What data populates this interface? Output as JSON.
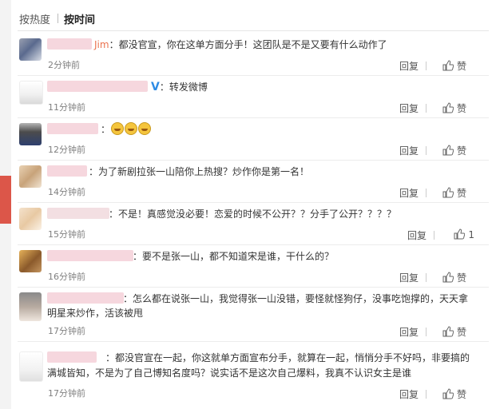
{
  "tabs": {
    "hot": "按热度",
    "time": "按时间"
  },
  "actions": {
    "reply": "回复",
    "like": "赞"
  },
  "comments": [
    {
      "name_visible": "Jim",
      "text": "：都没官宣，你在这单方面分手！这团队是不是又要有什么动作了",
      "time": "2分钟前",
      "likes": ""
    },
    {
      "badge": "V",
      "text": "：转发微博",
      "time": "11分钟前",
      "likes": ""
    },
    {
      "text": "：",
      "time": "12分钟前",
      "likes": ""
    },
    {
      "text": "：为了新剧拉张一山陪你上热搜？炒作你是第一名！",
      "time": "14分钟前",
      "likes": ""
    },
    {
      "text": "：不是！真感觉没必要！恋爱的时候不公开？？分手了公开？？？？",
      "time": "15分钟前",
      "likes": "1"
    },
    {
      "text": "：要不是张一山，都不知道宋是谁，干什么的？",
      "time": "16分钟前",
      "likes": ""
    },
    {
      "text_line1": "：怎么都在说张一山，我觉得张一山没错，要怪就怪狗仔，没事吃饱撑的，天天拿",
      "text_line2": "明星来炒作，活该被甩",
      "time": "17分钟前",
      "likes": ""
    },
    {
      "text_line1": "：都没官宣在一起，你这就单方面宣布分手，就算在一起，悄悄分手不好吗，非要搞的",
      "text_line2": "满城皆知，不是为了自己博知名度吗？说实话不是这次自己爆料，我真不认识女主是谁",
      "time": "17分钟前",
      "likes": ""
    }
  ]
}
